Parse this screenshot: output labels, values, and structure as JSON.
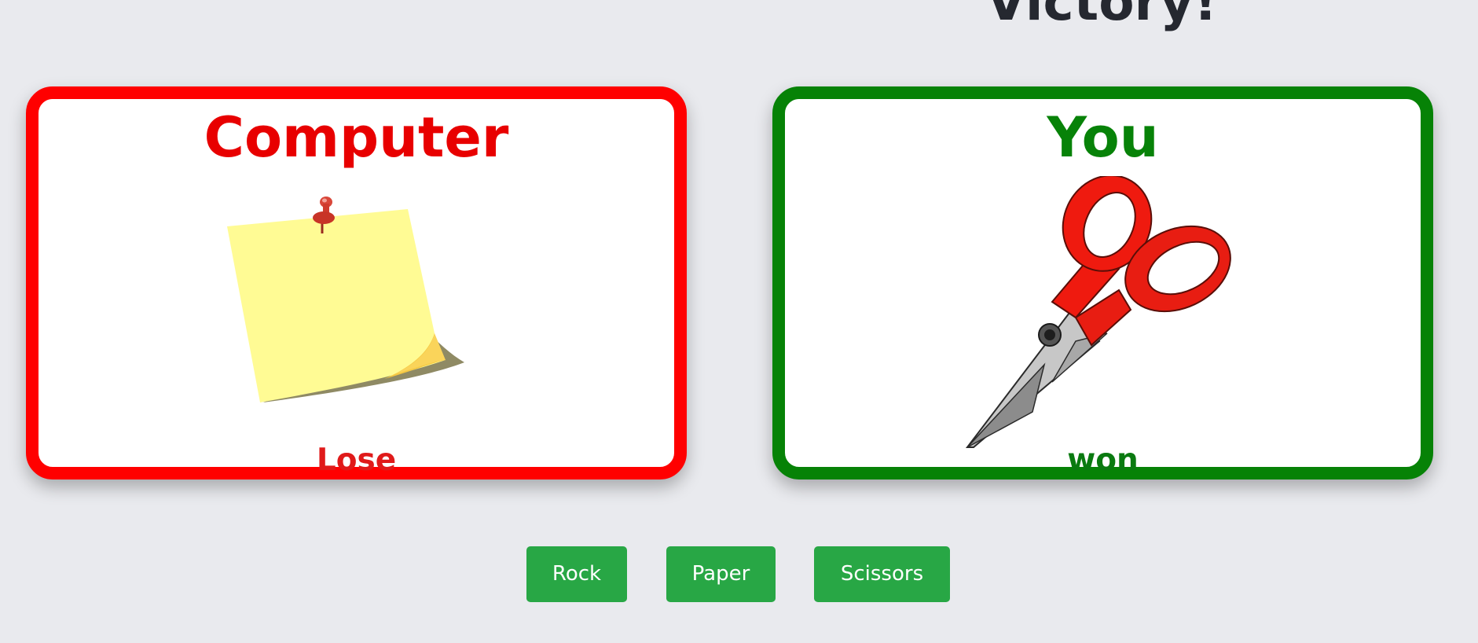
{
  "result": {
    "title": "Victory!"
  },
  "computer_card": {
    "title": "Computer",
    "choice_icon": "paper-icon",
    "status": "Lose",
    "border_color": "#ff0000"
  },
  "player_card": {
    "title": "You",
    "choice_icon": "scissors-icon",
    "status": "won",
    "border_color": "#068206"
  },
  "buttons": {
    "rock_label": "Rock",
    "paper_label": "Paper",
    "scissors_label": "Scissors",
    "color": "#28a745"
  }
}
